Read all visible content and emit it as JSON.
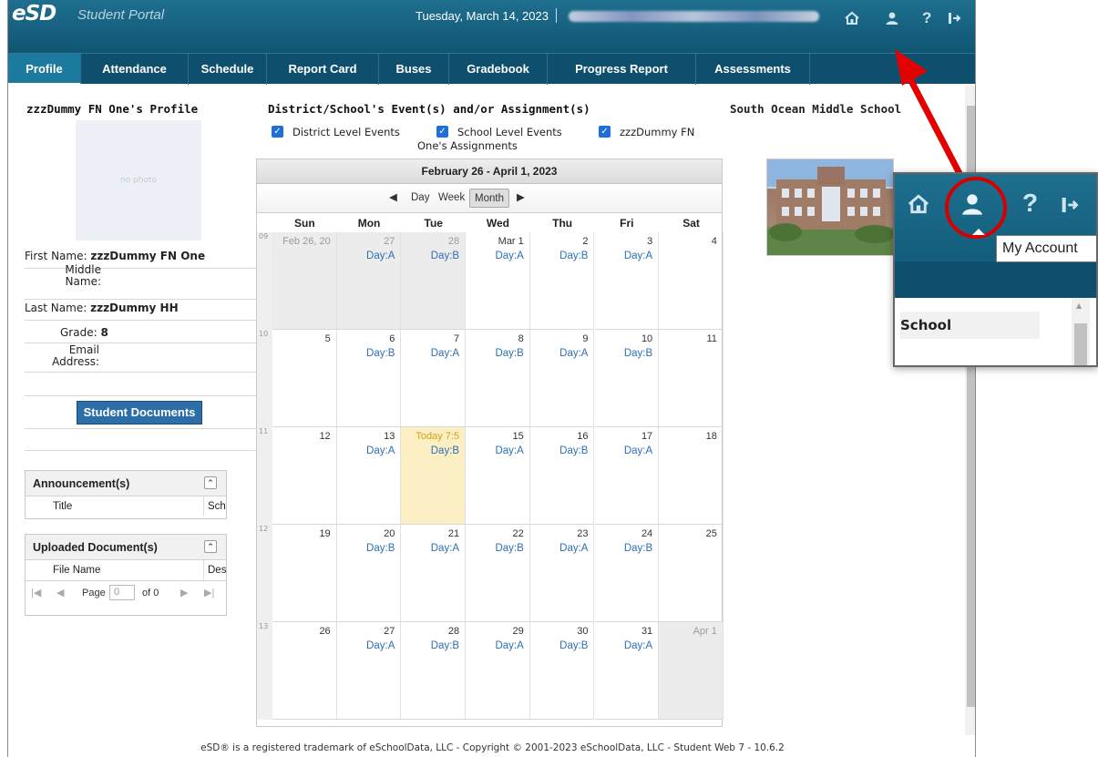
{
  "header": {
    "logo": "eSD",
    "portal_name": "Student Portal",
    "date": "Tuesday, March 14, 2023",
    "icons": [
      "home-icon",
      "user-icon",
      "help-icon",
      "logout-icon"
    ]
  },
  "nav": {
    "tabs": [
      "Profile",
      "Attendance",
      "Schedule",
      "Report Card",
      "Buses",
      "Gradebook",
      "Progress Report",
      "Assessments"
    ],
    "active": "Profile"
  },
  "profile": {
    "title": "zzzDummy FN One's Profile",
    "photo_text": "no photo",
    "first_name_label": "First Name:",
    "first_name": "zzzDummy FN One",
    "middle_name_label": "Middle\nName:",
    "last_name_label": "Last Name:",
    "last_name": "zzzDummy HH",
    "grade_label": "Grade:",
    "grade": "8",
    "email_label": "Email\nAddress:",
    "documents_button": "Student Documents"
  },
  "announcements": {
    "title": "Announcement(s)",
    "columns": [
      "Title",
      "Scho"
    ]
  },
  "uploaded": {
    "title": "Uploaded Document(s)",
    "columns": [
      "File Name",
      "Desc"
    ],
    "pager": {
      "page_label": "Page",
      "page_value": "0",
      "of_label": "of 0"
    }
  },
  "events": {
    "title": "District/School's Event(s) and/or Assignment(s)",
    "checkboxes": [
      {
        "label": "District Level Events",
        "checked": true
      },
      {
        "label": "School Level Events",
        "checked": true
      },
      {
        "label": "zzzDummy FN",
        "checked": true
      }
    ],
    "second_line": "One's Assignments"
  },
  "calendar": {
    "range": "February 26 - April 1, 2023",
    "view_buttons": [
      "Day",
      "Week",
      "Month"
    ],
    "selected_view": "Month",
    "days": [
      "Sun",
      "Mon",
      "Tue",
      "Wed",
      "Thu",
      "Fri",
      "Sat"
    ],
    "weeks": [
      {
        "num": "09",
        "cells": [
          {
            "n": "Feb 26, 20",
            "other": true
          },
          {
            "n": "27",
            "label": "Day:A",
            "other": true
          },
          {
            "n": "28",
            "label": "Day:B",
            "other": true
          },
          {
            "n": "Mar 1",
            "label": "Day:A"
          },
          {
            "n": "2",
            "label": "Day:B"
          },
          {
            "n": "3",
            "label": "Day:A"
          },
          {
            "n": "4"
          }
        ]
      },
      {
        "num": "10",
        "cells": [
          {
            "n": "5"
          },
          {
            "n": "6",
            "label": "Day:B"
          },
          {
            "n": "7",
            "label": "Day:A"
          },
          {
            "n": "8",
            "label": "Day:B"
          },
          {
            "n": "9",
            "label": "Day:A"
          },
          {
            "n": "10",
            "label": "Day:B"
          },
          {
            "n": "11"
          }
        ]
      },
      {
        "num": "11",
        "cells": [
          {
            "n": "12"
          },
          {
            "n": "13",
            "label": "Day:A"
          },
          {
            "n": "Today 7:5",
            "label": "Day:B",
            "today": true
          },
          {
            "n": "15",
            "label": "Day:A"
          },
          {
            "n": "16",
            "label": "Day:B"
          },
          {
            "n": "17",
            "label": "Day:A"
          },
          {
            "n": "18"
          }
        ]
      },
      {
        "num": "12",
        "cells": [
          {
            "n": "19"
          },
          {
            "n": "20",
            "label": "Day:B"
          },
          {
            "n": "21",
            "label": "Day:A"
          },
          {
            "n": "22",
            "label": "Day:B"
          },
          {
            "n": "23",
            "label": "Day:A"
          },
          {
            "n": "24",
            "label": "Day:B"
          },
          {
            "n": "25"
          }
        ]
      },
      {
        "num": "13",
        "cells": [
          {
            "n": "26"
          },
          {
            "n": "27",
            "label": "Day:A"
          },
          {
            "n": "28",
            "label": "Day:B"
          },
          {
            "n": "29",
            "label": "Day:A"
          },
          {
            "n": "30",
            "label": "Day:B"
          },
          {
            "n": "31",
            "label": "Day:A"
          },
          {
            "n": "Apr 1",
            "other": true
          }
        ]
      }
    ]
  },
  "school": {
    "name": "South Ocean Middle School"
  },
  "callout": {
    "tooltip": "My Account",
    "section": "School"
  },
  "footer": {
    "text": "eSD® is a registered trademark of eSchoolData, LLC - Copyright © 2001-2023 eSchoolData, LLC - Student Web 7 - 10.6.2"
  },
  "colors": {
    "header": "#0f5573",
    "nav": "#0d4f6c",
    "active_tab": "#1d7a9f",
    "button": "#2c6ea8",
    "today": "#fcefc4",
    "arrow": "#e30000"
  }
}
